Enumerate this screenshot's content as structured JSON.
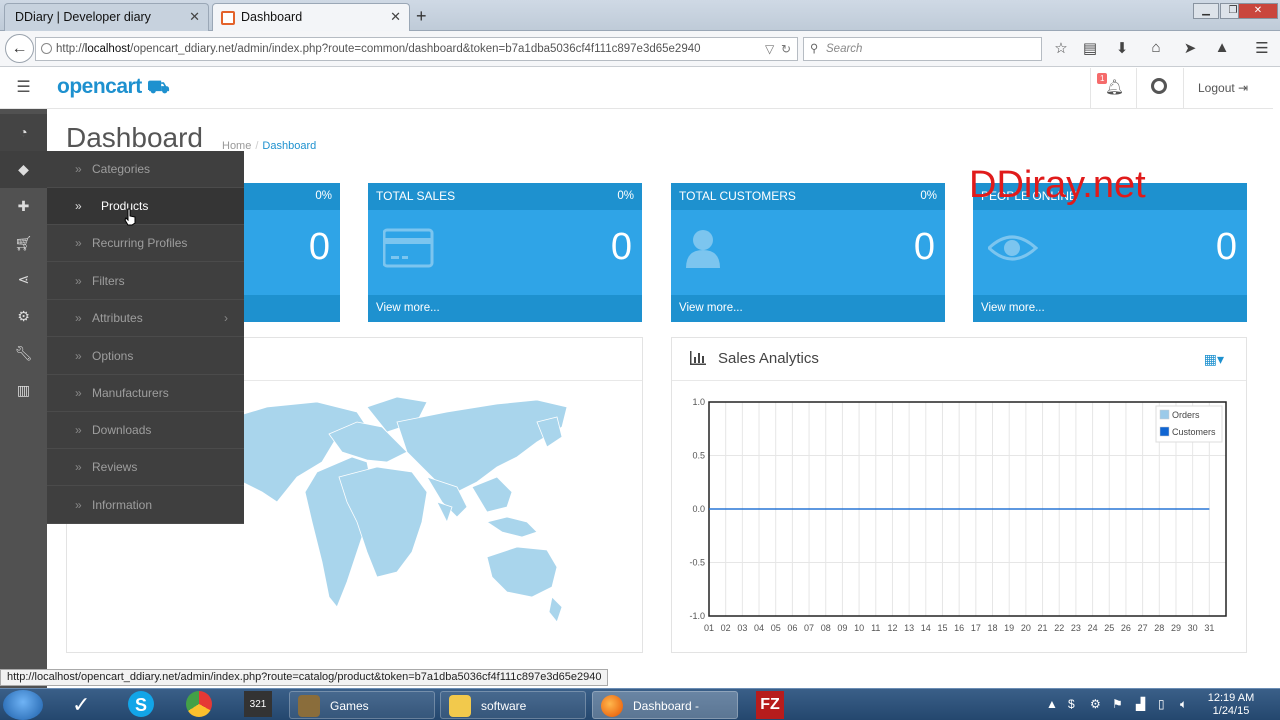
{
  "browser": {
    "tabs": [
      {
        "title": "DDiary | Developer diary",
        "active": false
      },
      {
        "title": "Dashboard",
        "active": true
      }
    ],
    "url_prefix": "http://",
    "url_host": "localhost",
    "url_rest": "/opencart_ddiary.net/admin/index.php?route=common/dashboard&token=b7a1dba5036cf4f111c897e3d65e2940",
    "search_placeholder": "Search",
    "status_url": "http://localhost/opencart_ddiary.net/admin/index.php?route=catalog/product&token=b7a1dba5036cf4f111c897e3d65e2940"
  },
  "header": {
    "logo": "opencart",
    "notification_count": "1",
    "logout": "Logout"
  },
  "catalog_menu": {
    "items": [
      {
        "label": "Categories"
      },
      {
        "label": "Products"
      },
      {
        "label": "Recurring Profiles"
      },
      {
        "label": "Filters"
      },
      {
        "label": "Attributes"
      },
      {
        "label": "Options"
      },
      {
        "label": "Manufacturers"
      },
      {
        "label": "Downloads"
      },
      {
        "label": "Reviews"
      },
      {
        "label": "Information"
      }
    ]
  },
  "page": {
    "title": "Dashboard",
    "breadcrumb_home": "Home",
    "breadcrumb_current": "Dashboard"
  },
  "tiles": [
    {
      "title": "",
      "percent": "0%",
      "value": "0",
      "footer": ""
    },
    {
      "title": "Total Sales",
      "percent": "0%",
      "value": "0",
      "footer": "View more..."
    },
    {
      "title": "Total Customers",
      "percent": "0%",
      "value": "0",
      "footer": "View more..."
    },
    {
      "title": "People Online",
      "percent": "",
      "value": "0",
      "footer": "View more..."
    }
  ],
  "watermark": "DDiray.net",
  "sales_panel": {
    "title": "Sales Analytics"
  },
  "chart_data": {
    "type": "line",
    "title": "Sales Analytics",
    "x": [
      "01",
      "02",
      "03",
      "04",
      "05",
      "06",
      "07",
      "08",
      "09",
      "10",
      "11",
      "12",
      "13",
      "14",
      "15",
      "16",
      "17",
      "18",
      "19",
      "20",
      "21",
      "22",
      "23",
      "24",
      "25",
      "26",
      "27",
      "28",
      "29",
      "30",
      "31"
    ],
    "ylim": [
      -1.0,
      1.0
    ],
    "yticks": [
      "1.0",
      "0.5",
      "0.0",
      "-0.5",
      "-1.0"
    ],
    "series": [
      {
        "name": "Orders",
        "color": "#9bcae9",
        "values": [
          0,
          0,
          0,
          0,
          0,
          0,
          0,
          0,
          0,
          0,
          0,
          0,
          0,
          0,
          0,
          0,
          0,
          0,
          0,
          0,
          0,
          0,
          0,
          0,
          0,
          0,
          0,
          0,
          0,
          0,
          0
        ]
      },
      {
        "name": "Customers",
        "color": "#1065d2",
        "values": [
          0,
          0,
          0,
          0,
          0,
          0,
          0,
          0,
          0,
          0,
          0,
          0,
          0,
          0,
          0,
          0,
          0,
          0,
          0,
          0,
          0,
          0,
          0,
          0,
          0,
          0,
          0,
          0,
          0,
          0,
          0
        ]
      }
    ],
    "legend": "top-right",
    "grid": true
  },
  "taskbar": {
    "apps": [
      {
        "label": "Games"
      },
      {
        "label": "software"
      },
      {
        "label": "Dashboard - Mozi..."
      }
    ],
    "time": "12:19 AM",
    "date": "1/24/15"
  }
}
